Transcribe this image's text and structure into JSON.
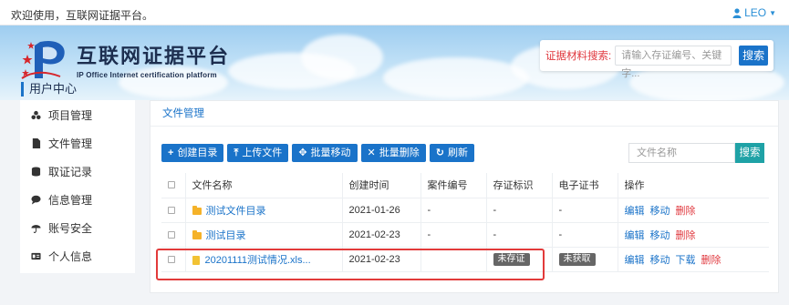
{
  "topbar": {
    "welcome": "欢迎使用，互联网证据平台。",
    "user": "LEO",
    "user_icon": "user-icon"
  },
  "brand": {
    "title": "互联网证据平台",
    "subtitle": "IP Office Internet certification platform"
  },
  "header_search": {
    "label": "证据材料搜索:",
    "placeholder": "请输入存证编号、关键字...",
    "button": "搜索"
  },
  "user_center": {
    "title": "用户中心"
  },
  "sidebar": {
    "items": [
      {
        "label": "项目管理",
        "icon": "project-icon"
      },
      {
        "label": "文件管理",
        "icon": "file-icon"
      },
      {
        "label": "取证记录",
        "icon": "record-icon"
      },
      {
        "label": "信息管理",
        "icon": "comment-icon"
      },
      {
        "label": "账号安全",
        "icon": "umbrella-icon"
      },
      {
        "label": "个人信息",
        "icon": "id-card-icon"
      }
    ]
  },
  "panel": {
    "breadcrumb": "文件管理"
  },
  "toolbar": {
    "create_dir": "创建目录",
    "upload": "上传文件",
    "batch_move": "批量移动",
    "batch_delete": "批量删除",
    "refresh": "刷新"
  },
  "file_search": {
    "placeholder": "文件名称",
    "button": "搜索"
  },
  "table": {
    "headers": [
      "文件名称",
      "创建时间",
      "案件编号",
      "存证标识",
      "电子证书",
      "操作"
    ],
    "rows": [
      {
        "name": "测试文件目录",
        "created": "2021-01-26",
        "case_no": "-",
        "evidence": "-",
        "cert": "-",
        "actions": [
          "编辑",
          "移动",
          "删除"
        ]
      },
      {
        "name": "测试目录",
        "created": "2021-02-23",
        "case_no": "-",
        "evidence": "-",
        "cert": "-",
        "actions": [
          "编辑",
          "移动",
          "删除"
        ]
      },
      {
        "name": "20201111测试情况.xls...",
        "created": "2021-02-23",
        "case_no": "",
        "evidence": "未存证",
        "cert": "未获取",
        "actions": [
          "编辑",
          "移动",
          "下载",
          "删除"
        ]
      }
    ]
  },
  "colors": {
    "primary": "#1a73c9",
    "danger": "#e0383e",
    "teal": "#1fa2a6"
  }
}
